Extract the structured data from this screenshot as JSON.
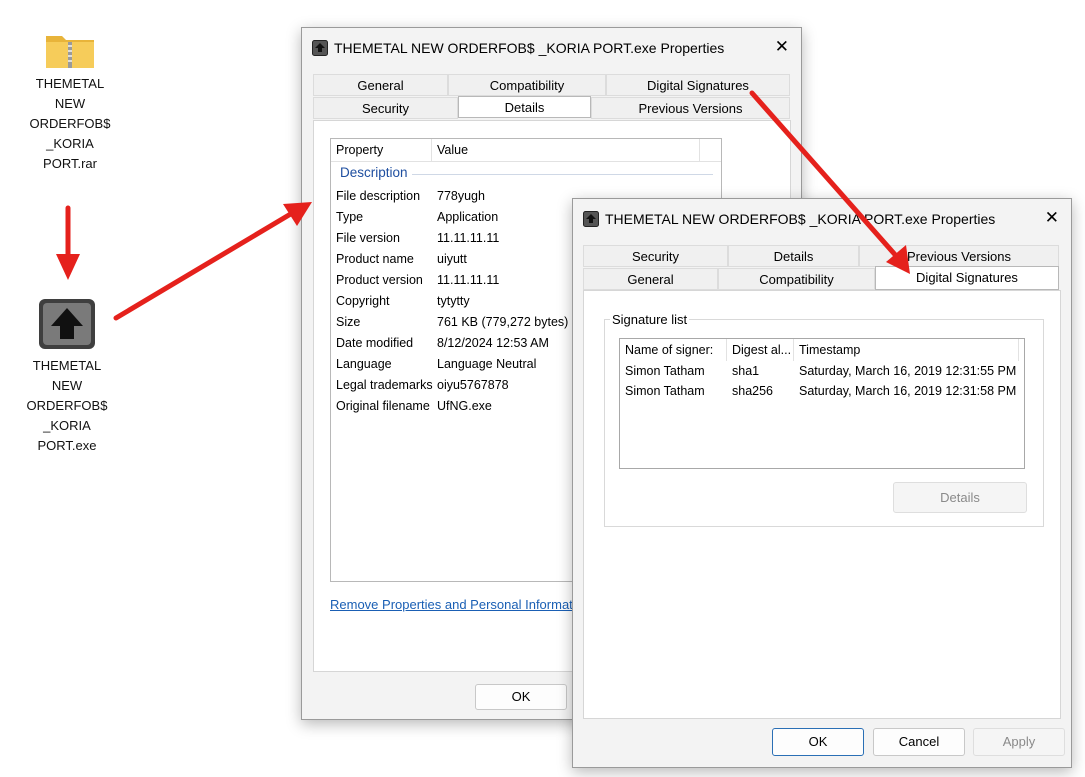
{
  "desktop": {
    "rar_icon_lines": [
      "THEMETAL",
      "NEW",
      "ORDERFOB$",
      "_KORIA",
      "PORT.rar"
    ],
    "exe_icon_lines": [
      "THEMETAL",
      "NEW",
      "ORDERFOB$",
      "_KORIA",
      "PORT.exe"
    ]
  },
  "dialog_details": {
    "title": "THEMETAL NEW ORDERFOB$ _KORIA PORT.exe Properties",
    "close_glyph": "✕",
    "tabs_row1": [
      "General",
      "Compatibility",
      "Digital Signatures"
    ],
    "tabs_row2": [
      "Security",
      "Details",
      "Previous Versions"
    ],
    "active_tab": "Details",
    "column_property": "Property",
    "column_value": "Value",
    "section": "Description",
    "properties": [
      {
        "name": "File description",
        "value": "778yugh"
      },
      {
        "name": "Type",
        "value": "Application"
      },
      {
        "name": "File version",
        "value": "11.11.11.11"
      },
      {
        "name": "Product name",
        "value": "uiyutt"
      },
      {
        "name": "Product version",
        "value": "11.11.11.11"
      },
      {
        "name": "Copyright",
        "value": "tytytty"
      },
      {
        "name": "Size",
        "value": "761 KB (779,272 bytes)"
      },
      {
        "name": "Date modified",
        "value": "8/12/2024 12:53 AM"
      },
      {
        "name": "Language",
        "value": "Language Neutral"
      },
      {
        "name": "Legal trademarks",
        "value": "oiyu5767878"
      },
      {
        "name": "Original filename",
        "value": "UfNG.exe"
      }
    ],
    "remove_link": "Remove Properties and Personal Informatio",
    "ok_label": "OK"
  },
  "dialog_signatures": {
    "title": "THEMETAL NEW ORDERFOB$ _KORIA PORT.exe Properties",
    "close_glyph": "✕",
    "tabs_row1": [
      "Security",
      "Details",
      "Previous Versions"
    ],
    "tabs_row2": [
      "General",
      "Compatibility",
      "Digital Signatures"
    ],
    "active_tab": "Digital Signatures",
    "group_label": "Signature list",
    "columns": [
      "Name of signer:",
      "Digest al...",
      "Timestamp"
    ],
    "signatures": [
      {
        "signer": "Simon Tatham",
        "digest": "sha1",
        "timestamp": "Saturday, March 16, 2019 12:31:55 PM"
      },
      {
        "signer": "Simon Tatham",
        "digest": "sha256",
        "timestamp": "Saturday, March 16, 2019 12:31:58 PM"
      }
    ],
    "details_button": "Details",
    "ok_label": "OK",
    "cancel_label": "Cancel",
    "apply_label": "Apply"
  },
  "colors": {
    "arrow": "#e5211c",
    "link": "#1a5fb4",
    "section": "#1f4fa0",
    "folder": "#f4c542"
  }
}
